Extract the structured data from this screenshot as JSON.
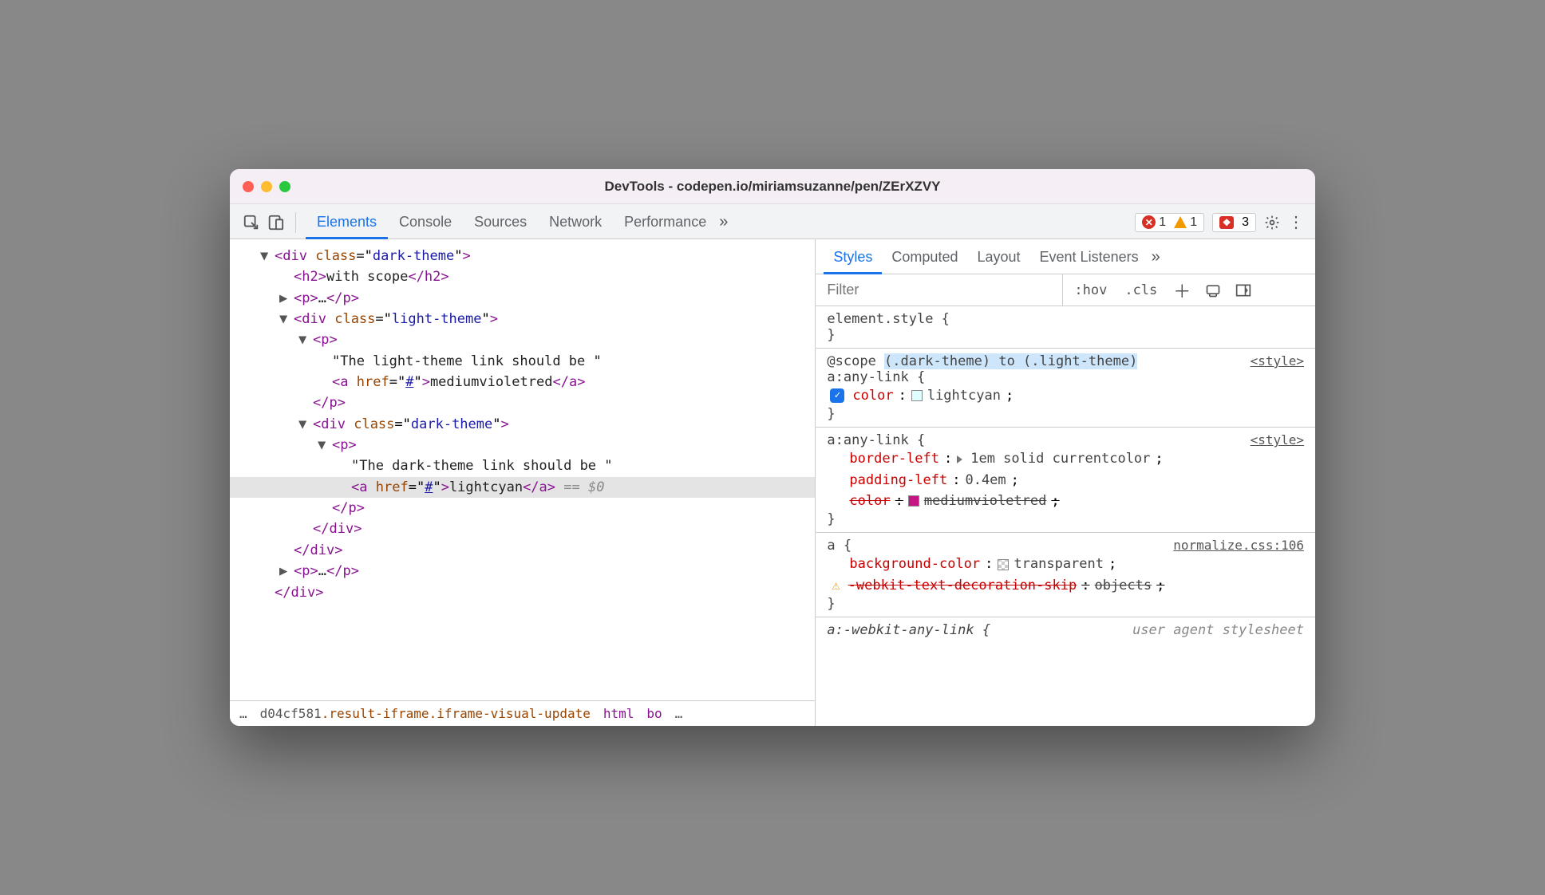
{
  "window_title": "DevTools - codepen.io/miriamsuzanne/pen/ZErXZVY",
  "tabs": [
    "Elements",
    "Console",
    "Sources",
    "Network",
    "Performance"
  ],
  "counts": {
    "errors": "1",
    "warnings": "1",
    "issues": "3"
  },
  "dom": {
    "l1_open": "<div class=\"dark-theme\">",
    "l2_h2": "<h2>with scope</h2>",
    "l2_p1": "<p>…</p>",
    "l2_div_open": "<div class=\"light-theme\">",
    "l3_p_open": "<p>",
    "l4_text1": "\"The light-theme link should be \"",
    "l4_a_open": "<a href=\"",
    "l4_a_href": "#",
    "l4_a_mid": "\">",
    "l4_a_text": "mediumvioletred",
    "l4_a_close": "</a>",
    "l3_p_close": "</p>",
    "l3_div_open": "<div class=\"dark-theme\">",
    "l4_p_open": "<p>",
    "l5_text2": "\"The dark-theme link should be \"",
    "l5_a_open": "<a href=\"",
    "l5_a_href": "#",
    "l5_a_mid": "\">",
    "l5_a_text": "lightcyan",
    "l5_a_close": "</a>",
    "l5_sel": " == $0",
    "l4_p_close": "</p>",
    "l3_div_close": "</div>",
    "l2_div_close": "</div>",
    "l2_p2": "<p>…</p>",
    "l1_close": "</div>"
  },
  "breadcrumb": {
    "ellipsis": "…",
    "id": "d04cf581",
    "classes": ".result-iframe.iframe-visual-update",
    "items": [
      "html",
      "bo"
    ],
    "trail_ellipsis": "…"
  },
  "styles_tabs": [
    "Styles",
    "Computed",
    "Layout",
    "Event Listeners"
  ],
  "filter_placeholder": "Filter",
  "filter_btns": {
    "hov": ":hov",
    "cls": ".cls"
  },
  "rules": {
    "r0_sel": "element.style {",
    "r0_close": "}",
    "r1_scope_pre": "@scope ",
    "r1_scope_hl": "(.dark-theme) to (.light-theme)",
    "r1_sel": "a:any-link {",
    "r1_src": "<style>",
    "r1_p1_prop": "color",
    "r1_p1_val": "lightcyan",
    "r1_close": "}",
    "r2_sel": "a:any-link {",
    "r2_src": "<style>",
    "r2_p1_prop": "border-left",
    "r2_p1_val": "1em solid currentcolor",
    "r2_p2_prop": "padding-left",
    "r2_p2_val": "0.4em",
    "r2_p3_prop": "color",
    "r2_p3_val": "mediumvioletred",
    "r2_close": "}",
    "r3_sel": "a {",
    "r3_src": "normalize.css:106",
    "r3_p1_prop": "background-color",
    "r3_p1_val": "transparent",
    "r3_p2_prop": "-webkit-text-decoration-skip",
    "r3_p2_val": "objects",
    "r3_close": "}",
    "r4_sel": "a:-webkit-any-link {",
    "r4_src": "user agent stylesheet"
  },
  "colors": {
    "lightcyan_swatch": "#e0ffff",
    "mediumvioletred_swatch": "#c71585",
    "transparent_swatch": "#ffffff"
  }
}
